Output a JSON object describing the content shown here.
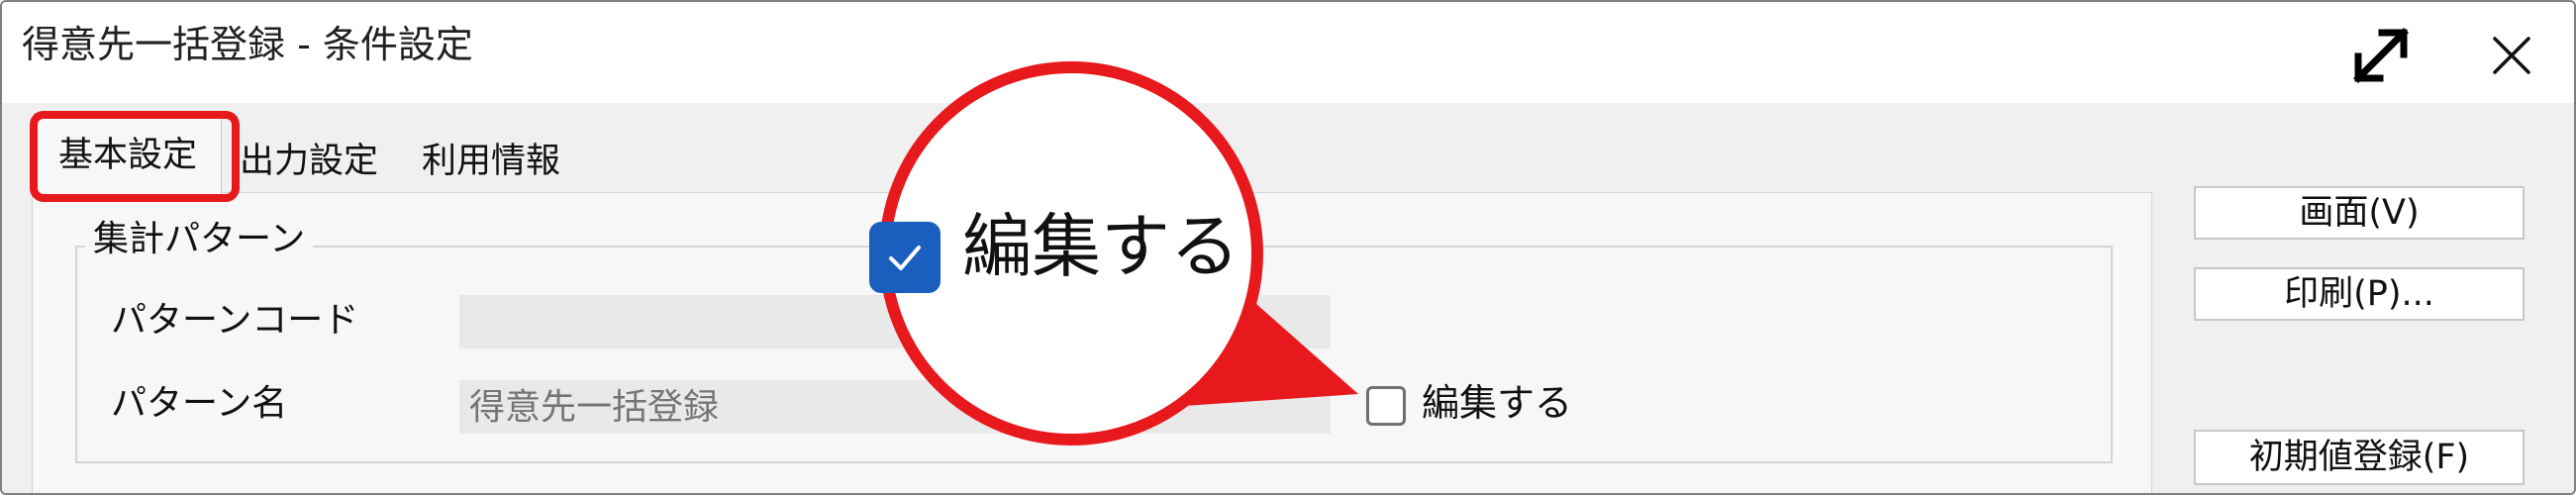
{
  "window": {
    "title": "得意先一括登録 - 条件設定"
  },
  "tabs": [
    {
      "label": "基本設定",
      "selected": true
    },
    {
      "label": "出力設定",
      "selected": false
    },
    {
      "label": "利用情報",
      "selected": false
    }
  ],
  "pattern_group": {
    "legend": "集計パターン",
    "code_label": "パターンコード",
    "code_value": "",
    "name_label": "パターン名",
    "name_placeholder": "得意先一括登録",
    "edit_checkbox_label": "編集する",
    "edit_checked": false
  },
  "buttons": {
    "screen": "画面(V)",
    "print": "印刷(P)...",
    "initial_registration": "初期値登録(F)"
  },
  "callout": {
    "label": "編集する",
    "checked": true,
    "highlight_color": "#e8191d",
    "checkbox_color": "#1b5fbe"
  },
  "icons": {
    "maximize": "maximize-icon",
    "close": "close-icon",
    "checkmark": "checkmark-icon"
  }
}
